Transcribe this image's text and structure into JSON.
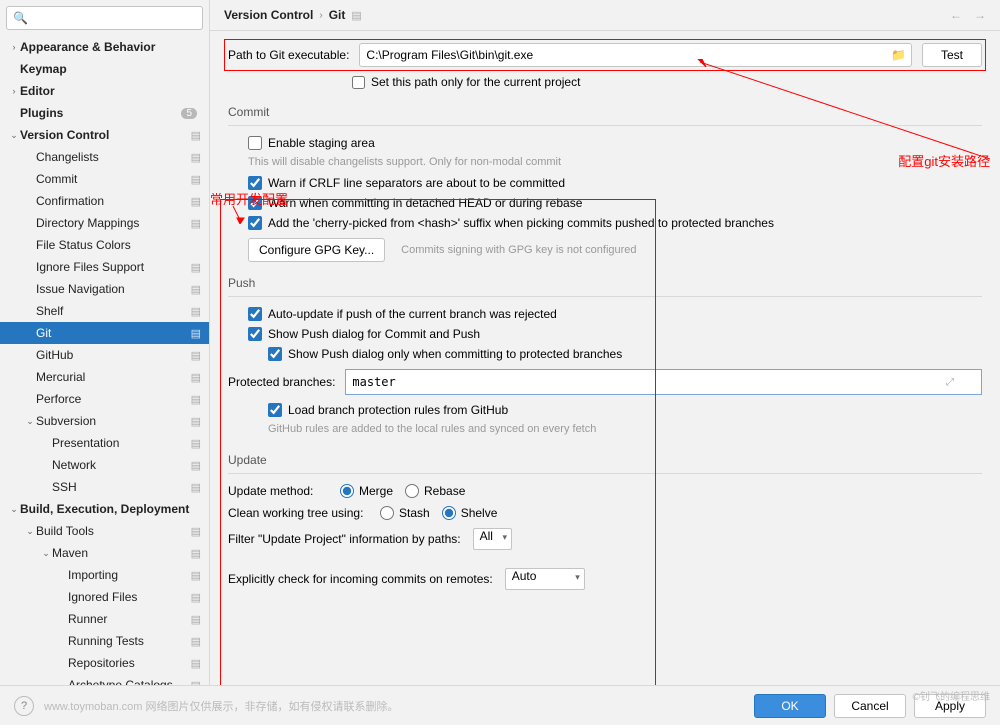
{
  "search": {
    "placeholder": ""
  },
  "sidebar": {
    "items": [
      {
        "label": "Appearance & Behavior",
        "indent": 0,
        "caret": "›",
        "bold": true,
        "gear": false
      },
      {
        "label": "Keymap",
        "indent": 0,
        "caret": "",
        "bold": true,
        "gear": false
      },
      {
        "label": "Editor",
        "indent": 0,
        "caret": "›",
        "bold": true,
        "gear": false
      },
      {
        "label": "Plugins",
        "indent": 0,
        "caret": "",
        "bold": true,
        "gear": false,
        "badge": "5"
      },
      {
        "label": "Version Control",
        "indent": 0,
        "caret": "⌄",
        "bold": true,
        "gear": true
      },
      {
        "label": "Changelists",
        "indent": 1,
        "caret": "",
        "bold": false,
        "gear": true
      },
      {
        "label": "Commit",
        "indent": 1,
        "caret": "",
        "bold": false,
        "gear": true
      },
      {
        "label": "Confirmation",
        "indent": 1,
        "caret": "",
        "bold": false,
        "gear": true
      },
      {
        "label": "Directory Mappings",
        "indent": 1,
        "caret": "",
        "bold": false,
        "gear": true
      },
      {
        "label": "File Status Colors",
        "indent": 1,
        "caret": "",
        "bold": false,
        "gear": false
      },
      {
        "label": "Ignore Files Support",
        "indent": 1,
        "caret": "",
        "bold": false,
        "gear": true
      },
      {
        "label": "Issue Navigation",
        "indent": 1,
        "caret": "",
        "bold": false,
        "gear": true
      },
      {
        "label": "Shelf",
        "indent": 1,
        "caret": "",
        "bold": false,
        "gear": true
      },
      {
        "label": "Git",
        "indent": 1,
        "caret": "",
        "bold": false,
        "gear": true,
        "selected": true
      },
      {
        "label": "GitHub",
        "indent": 1,
        "caret": "",
        "bold": false,
        "gear": true
      },
      {
        "label": "Mercurial",
        "indent": 1,
        "caret": "",
        "bold": false,
        "gear": true
      },
      {
        "label": "Perforce",
        "indent": 1,
        "caret": "",
        "bold": false,
        "gear": true
      },
      {
        "label": "Subversion",
        "indent": 1,
        "caret": "⌄",
        "bold": false,
        "gear": true
      },
      {
        "label": "Presentation",
        "indent": 2,
        "caret": "",
        "bold": false,
        "gear": true
      },
      {
        "label": "Network",
        "indent": 2,
        "caret": "",
        "bold": false,
        "gear": true
      },
      {
        "label": "SSH",
        "indent": 2,
        "caret": "",
        "bold": false,
        "gear": true
      },
      {
        "label": "Build, Execution, Deployment",
        "indent": 0,
        "caret": "⌄",
        "bold": true,
        "gear": false
      },
      {
        "label": "Build Tools",
        "indent": 1,
        "caret": "⌄",
        "bold": false,
        "gear": true
      },
      {
        "label": "Maven",
        "indent": 2,
        "caret": "⌄",
        "bold": false,
        "gear": true
      },
      {
        "label": "Importing",
        "indent": 3,
        "caret": "",
        "bold": false,
        "gear": true
      },
      {
        "label": "Ignored Files",
        "indent": 3,
        "caret": "",
        "bold": false,
        "gear": true
      },
      {
        "label": "Runner",
        "indent": 3,
        "caret": "",
        "bold": false,
        "gear": true
      },
      {
        "label": "Running Tests",
        "indent": 3,
        "caret": "",
        "bold": false,
        "gear": true
      },
      {
        "label": "Repositories",
        "indent": 3,
        "caret": "",
        "bold": false,
        "gear": true
      },
      {
        "label": "Archetype Catalogs",
        "indent": 3,
        "caret": "",
        "bold": false,
        "gear": true
      }
    ]
  },
  "breadcrumb": {
    "parent": "Version Control",
    "current": "Git",
    "gear": "⚙"
  },
  "path": {
    "label": "Path to Git executable:",
    "value": "C:\\Program Files\\Git\\bin\\git.exe",
    "test_btn": "Test",
    "set_only_project": "Set this path only for the current project"
  },
  "commit": {
    "title": "Commit",
    "enable_staging": "Enable staging area",
    "staging_hint": "This will disable changelists support. Only for non-modal commit",
    "warn_crlf": "Warn if CRLF line separators are about to be committed",
    "warn_detached": "Warn when committing in detached HEAD or during rebase",
    "add_cherry": "Add the 'cherry-picked from <hash>' suffix when picking commits pushed to protected branches",
    "gpg_btn": "Configure GPG Key...",
    "gpg_hint": "Commits signing with GPG key is not configured"
  },
  "push": {
    "title": "Push",
    "auto_update": "Auto-update if push of the current branch was rejected",
    "show_push": "Show Push dialog for Commit and Push",
    "show_push_protected": "Show Push dialog only when committing to protected branches",
    "protected_label": "Protected branches:",
    "protected_value": "master",
    "load_branch": "Load branch protection rules from GitHub",
    "load_hint": "GitHub rules are added to the local rules and synced on every fetch"
  },
  "update": {
    "title": "Update",
    "method_label": "Update method:",
    "method_merge": "Merge",
    "method_rebase": "Rebase",
    "clean_label": "Clean working tree using:",
    "clean_stash": "Stash",
    "clean_shelve": "Shelve",
    "filter_label": "Filter \"Update Project\" information by paths:",
    "filter_value": "All",
    "explicit_label": "Explicitly check for incoming commits on remotes:",
    "explicit_value": "Auto"
  },
  "annotations": {
    "config_path": "配置git安装路径",
    "dev_config": "常用开发配置"
  },
  "footer": {
    "watermark": "www.toymoban.com 网络图片仅供展示，非存储，如有侵权请联系删除。",
    "tag": "©钊飞的编程思维",
    "ok": "OK",
    "cancel": "Cancel",
    "apply": "Apply"
  }
}
